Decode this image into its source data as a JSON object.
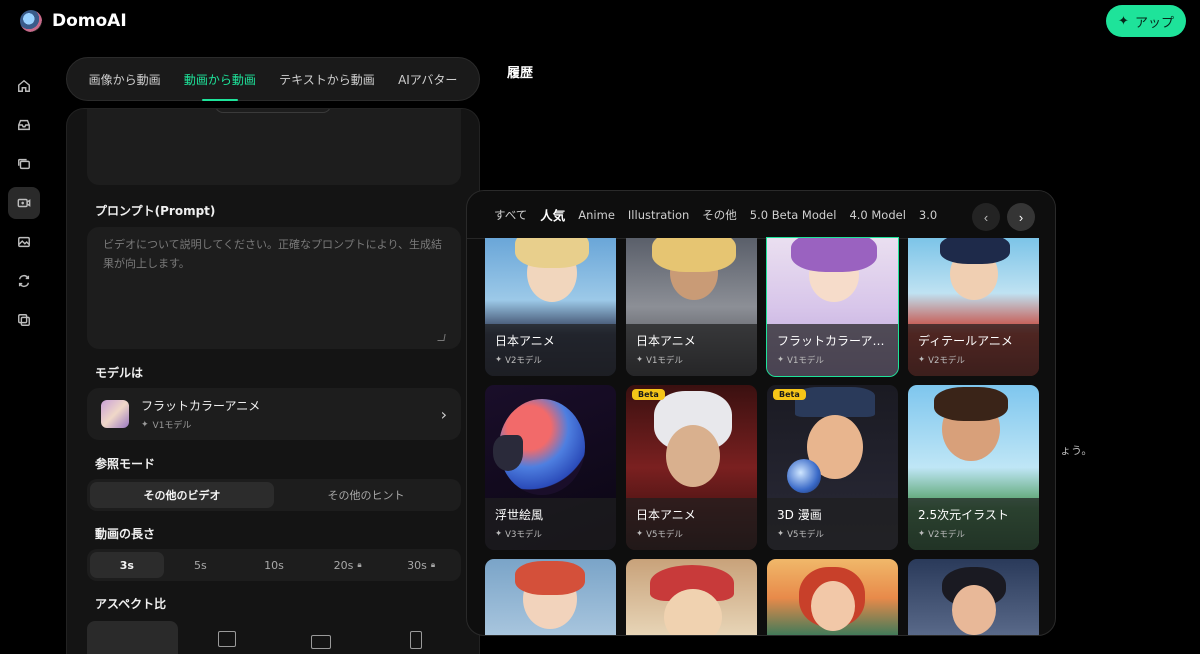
{
  "app": {
    "name": "DomoAI",
    "upgrade_label": "アップ"
  },
  "sidebar": {
    "items": [
      {
        "icon": "home-icon"
      },
      {
        "icon": "inbox-icon"
      },
      {
        "icon": "layers-icon"
      },
      {
        "icon": "video-icon",
        "active": true
      },
      {
        "icon": "image-icon"
      },
      {
        "icon": "repeat-icon"
      },
      {
        "icon": "copy-icon"
      }
    ]
  },
  "mode_tabs": [
    "画像から動画",
    "動画から動画",
    "テキストから動画",
    "AIアバター"
  ],
  "active_mode": "動画から動画",
  "panel": {
    "prompt_label": "プロンプト(Prompt)",
    "prompt_placeholder": "ビデオについて説明してください。正確なプロンプトにより、生成結果が向上します。",
    "model_label": "モデルは",
    "model_name": "フラットカラーアニメ",
    "model_version": "V1モデル",
    "reference_label": "参照モード",
    "reference_options": [
      "その他のビデオ",
      "その他のヒント"
    ],
    "length_label": "動画の長さ",
    "length_options": [
      "3s",
      "5s",
      "10s",
      "20s",
      "30s"
    ],
    "aspect_label": "アスペクト比"
  },
  "history": {
    "title": "履歴",
    "trailing_text": "ょう。"
  },
  "picker": {
    "categories": [
      "すべて",
      "人気",
      "Anime",
      "Illustration",
      "その他",
      "5.0 Beta Model",
      "4.0 Model",
      "3.0"
    ],
    "active_category": "人気",
    "prev_label": "‹",
    "next_label": "›",
    "models": [
      {
        "name": "日本アニメ",
        "version": "V2モデル"
      },
      {
        "name": "日本アニメ",
        "version": "V1モデル"
      },
      {
        "name": "フラットカラーア…",
        "version": "V1モデル",
        "selected": true
      },
      {
        "name": "ディテールアニメ",
        "version": "V2モデル"
      },
      {
        "name": "浮世絵風",
        "version": "V3モデル"
      },
      {
        "name": "日本アニメ",
        "version": "V5モデル",
        "badge": "Beta"
      },
      {
        "name": "3D 漫画",
        "version": "V5モデル",
        "badge": "Beta"
      },
      {
        "name": "2.5次元イラスト",
        "version": "V2モデル"
      }
    ]
  },
  "colors": {
    "accent": "#1ee39a",
    "beta_badge": "#f5c518"
  }
}
